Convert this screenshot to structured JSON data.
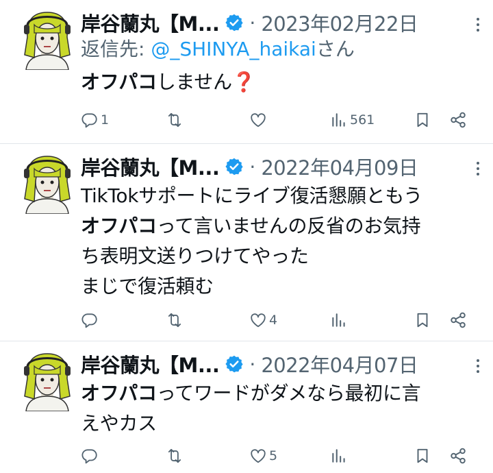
{
  "colors": {
    "text": "#0f1419",
    "muted": "#536471",
    "link": "#1d9bf0",
    "verified": "#1d9bf0",
    "divider": "#e1e6ea"
  },
  "tweets": [
    {
      "author_name": "岸谷蘭丸【M...",
      "separator": "·",
      "date": "2023年02月22日",
      "reply_to": {
        "prefix": "返信先: ",
        "handle": "@_SHINYA_haikai",
        "suffix": "さん"
      },
      "body": {
        "bold": "オフパコ",
        "rest": "しません",
        "emoji": "❓"
      },
      "stats": {
        "replies": "1",
        "retweets": "",
        "likes": "",
        "views": "561"
      }
    },
    {
      "author_name": "岸谷蘭丸【M...",
      "separator": "·",
      "date": "2022年04月09日",
      "body": {
        "line1": "TikTokサポートにライブ復活懇願ともう",
        "bold": "オフパコ",
        "line2_rest": "って言いませんの反省のお気持",
        "line3": "ち表明文送りつけてやった",
        "line4": "まじで復活頼む"
      },
      "stats": {
        "replies": "",
        "retweets": "",
        "likes": "4",
        "views": ""
      }
    },
    {
      "author_name": "岸谷蘭丸【M...",
      "separator": "·",
      "date": "2022年04月07日",
      "body": {
        "bold": "オフパコ",
        "line1_rest": "ってワードがダメなら最初に言",
        "line2": "えやカス"
      },
      "stats": {
        "replies": "",
        "retweets": "",
        "likes": "5",
        "views": ""
      }
    }
  ],
  "icons": [
    "reply-icon",
    "retweet-icon",
    "like-icon",
    "views-icon",
    "bookmark-icon",
    "share-icon",
    "verified-badge-icon",
    "more-icon"
  ]
}
